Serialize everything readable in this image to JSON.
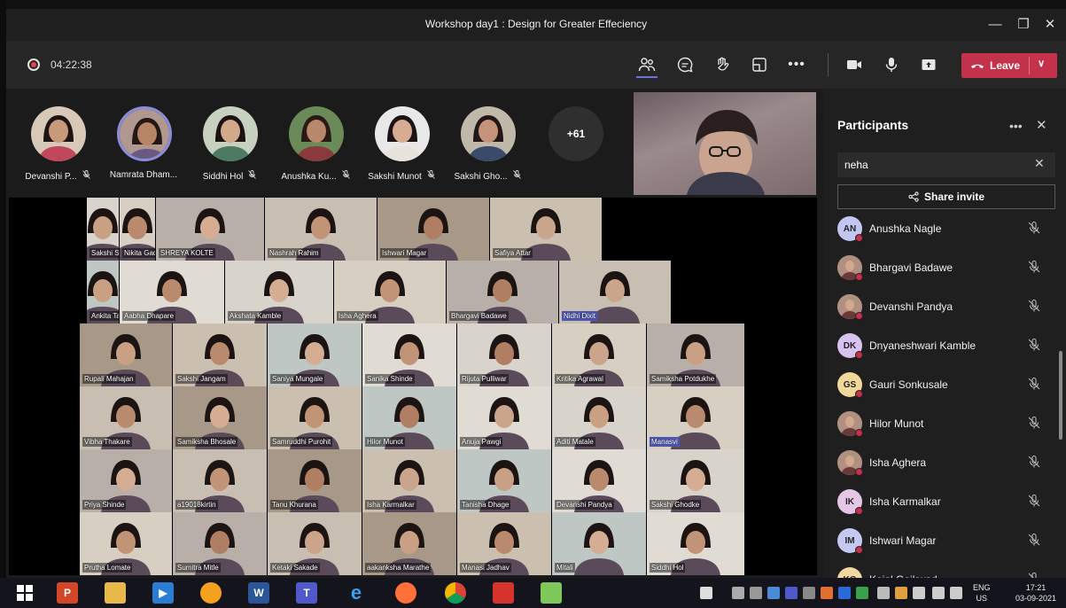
{
  "window": {
    "title": "Workshop day1 : Design for Greater Effeciency"
  },
  "toolbar": {
    "timer": "04:22:38",
    "leave_label": "Leave"
  },
  "colors": {
    "accent": "#6e74d5",
    "leave": "#c4314b",
    "panel_bg": "#1f1f1f"
  },
  "strip": {
    "people": [
      {
        "name": "Devanshi P...",
        "muted": true
      },
      {
        "name": "Namrata Dham...",
        "muted": false,
        "active": true
      },
      {
        "name": "Siddhi Hol",
        "muted": true
      },
      {
        "name": "Anushka Ku...",
        "muted": true
      },
      {
        "name": "Sakshi Munot",
        "muted": true
      },
      {
        "name": "Sakshi Gho...",
        "muted": true
      }
    ],
    "more": "+61"
  },
  "gallery": [
    "Sakshi Shah",
    "Nikita Gadgil",
    "SHREYA KOLTE",
    "Nashrah Rahim",
    "Ishwari Magar",
    "Safiya Attar",
    "Ankita Tambade",
    "Aabha Dhapare",
    "Akshata Kamble",
    "Isha Aghera",
    "Bhargavi Badawe",
    "Nidhi Dixit",
    "Rupali Mahajan",
    "Sakshi Jangam",
    "Saniya Mungale",
    "Sanika Shinde",
    "Rijuta Pulliwar",
    "Kritika Agrawal",
    "Samiksha Potdukhe",
    "Vibha Thakare",
    "Samiksha Bhosale",
    "Samruddhi Purohit",
    "Hilor Munot",
    "Anuja Pawgi",
    "Aditi Matale",
    "Manasvi",
    "Priya Shinde",
    "a19018kirtin",
    "Tanu Khurana",
    "Isha Karmalkar",
    "Tanisha Dhage",
    "Devanshi Pandya",
    "Sakshi Ghodke",
    "Prutha Lomate",
    "Sumitra Mitle",
    "Ketaki Sakade",
    "aakanksha Marathe",
    "Manasi Jadhav",
    "Mitali",
    "Siddhi Hol"
  ],
  "participants": {
    "title": "Participants",
    "search_value": "neha",
    "share_invite": "Share invite",
    "list": [
      {
        "name": "Anushka Nagle",
        "initials": "AN"
      },
      {
        "name": "Bhargavi Badawe",
        "initials": ""
      },
      {
        "name": "Devanshi Pandya",
        "initials": ""
      },
      {
        "name": "Dnyaneshwari Kamble",
        "initials": "DK"
      },
      {
        "name": "Gauri Sonkusale",
        "initials": "GS"
      },
      {
        "name": "Hilor Munot",
        "initials": ""
      },
      {
        "name": "Isha Aghera",
        "initials": ""
      },
      {
        "name": "Isha Karmalkar",
        "initials": "IK"
      },
      {
        "name": "Ishwari Magar",
        "initials": "IM"
      },
      {
        "name": "Kajal Gaikwad",
        "initials": "KG"
      }
    ]
  },
  "taskbar": {
    "lang_line1": "ENG",
    "lang_line2": "US",
    "time": "17:21",
    "date": "03-09-2021"
  }
}
